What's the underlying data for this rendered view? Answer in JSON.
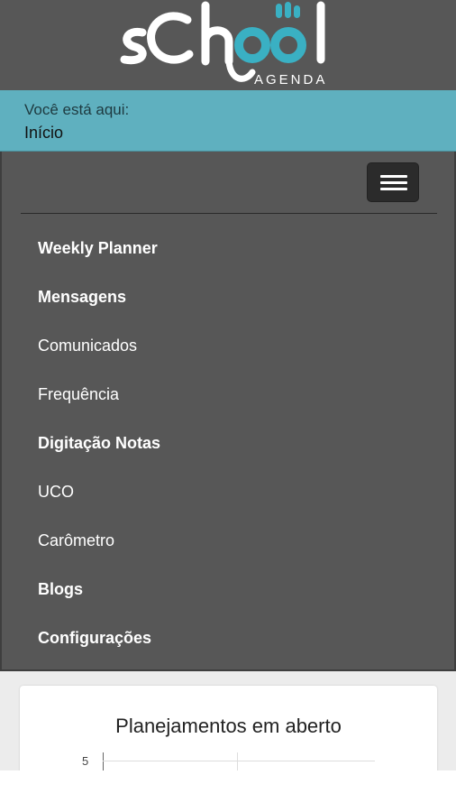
{
  "app": {
    "logo_text": "sChool",
    "logo_subtitle": "AGENDA"
  },
  "breadcrumb": {
    "label": "Você está aqui:",
    "current": "Início"
  },
  "menu": {
    "toggle_icon": "hamburger-icon",
    "items": [
      {
        "label": "Weekly Planner",
        "bold": true
      },
      {
        "label": "Mensagens",
        "bold": true
      },
      {
        "label": "Comunicados",
        "bold": false
      },
      {
        "label": "Frequência",
        "bold": false
      },
      {
        "label": "Digitação Notas",
        "bold": true
      },
      {
        "label": "UCO",
        "bold": false
      },
      {
        "label": "Carômetro",
        "bold": false
      },
      {
        "label": "Blogs",
        "bold": true
      },
      {
        "label": "Configurações",
        "bold": true
      }
    ]
  },
  "widget": {
    "title": "Planejamentos em aberto",
    "chart_tick": "5"
  },
  "colors": {
    "header_bg": "#575757",
    "breadcrumb_bg": "#5fb0bf",
    "logo_accent": "#3ab0c3",
    "content_bg": "#ececec"
  }
}
